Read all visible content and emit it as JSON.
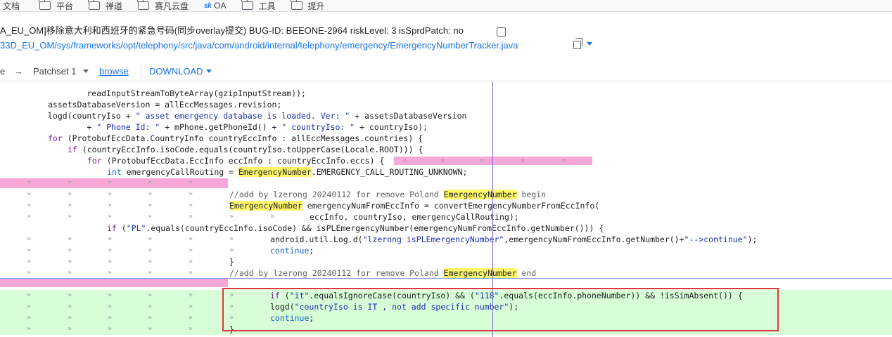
{
  "bookmarks": [
    {
      "label": "文档",
      "icon": "none"
    },
    {
      "label": "平台",
      "icon": "folder-icon"
    },
    {
      "label": "禅道",
      "icon": "folder-icon"
    },
    {
      "label": "赛凡云盘",
      "icon": "folder-icon"
    },
    {
      "label": "OA",
      "icon": "oa-logo-icon"
    },
    {
      "label": "工具",
      "icon": "folder-icon"
    },
    {
      "label": "提升",
      "icon": "folder-icon"
    }
  ],
  "oa_logo_text": "sk",
  "change": {
    "subject": "A_EU_OM]移除意大利和西班牙的紧急号码(同步overlay提交) BUG-ID: BEEONE-2964 riskLevel: 3 isSprdPatch: no",
    "file_path": "33D_EU_OM/sys/frameworks/opt/telephony/src/java/com/android/internal/telephony/emergency/EmergencyNumberTracker.java"
  },
  "toolbar": {
    "prev": "e",
    "arrow": "→",
    "patchset": "Patchset 1",
    "browse": "browse",
    "download": "DOWNLOAD"
  },
  "tab_glyph": "»",
  "diff_lines": [
    {
      "text": "        readInputStreamToByteArray(gzipInputStream));"
    },
    {
      "text": "assetsDatabaseVersion = allEccMessages.revision;"
    },
    {
      "p1": "logd(countryIso + ",
      "s1": "\" asset emergency database is loaded. Ver: \"",
      "p2": " + assetsDatabaseVersion"
    },
    {
      "p1": "        + ",
      "s1": "\" Phone Id: \"",
      "p2": " + mPhone.getPhoneId() + ",
      "s2": "\" countryIso: \"",
      "p3": " + countryIso);"
    },
    {
      "kw": "for",
      "rest": " (ProtobufEccData.CountryInfo countryEccInfo : allEccMessages.countries) {"
    },
    {
      "kw": "if",
      "rest": " (countryEccInfo.isoCode.equals(countryIso.toUpperCase(Locale.ROOT))) {"
    },
    {
      "kw": "for",
      "rest": " (ProtobufEccData.EccInfo eccInfo : countryEccInfo.eccs) {"
    },
    {
      "kw": "int",
      "p1": " emergencyCallRouting = ",
      "hl": "EmergencyNumber",
      "p2": ".EMERGENCY_CALL_ROUTING_UNKNOWN;"
    },
    {
      "cmt1": "//add by lzerong 20240112 for remove Poland ",
      "hl": "EmergencyNumber",
      "cmt2": " begin"
    },
    {
      "hl": "EmergencyNumber",
      "p1": " emergencyNumFromEccInfo = convertEmergencyNumberFromEccInfo("
    },
    {
      "text": "eccInfo, countryIso, emergencyCallRouting);"
    },
    {
      "kw": "if",
      "p1": " (",
      "s1": "\"PL\"",
      "p2": ".equals(countryEccInfo.isoCode) && isPLEmergencyNumber(emergencyNumFromEccInfo.getNumber())) {"
    },
    {
      "p1": "android.util.Log.d(",
      "s1": "\"lzerong isPLEmergencyNumber\"",
      "p2": ",emergencyNumFromEccInfo.getNumber()+",
      "s2": "\"-->continue\"",
      "p3": ");"
    },
    {
      "kw": "continue",
      "p1": ";"
    },
    {
      "text": "}"
    },
    {
      "cmt1": "//add by lzerong 20240112 for remove Poland ",
      "hl": "EmergencyNumber",
      "cmt2": " end"
    },
    {
      "kw": "if",
      "p1": " (",
      "s1": "\"it\"",
      "p2": ".equalsIgnoreCase(countryIso) && (",
      "s2": "\"118\"",
      "p3": ".equals(eccInfo.phoneNumber)) && !isSimAbsent()) {"
    },
    {
      "p1": "logd(",
      "s1": "\"countryIso is IT , not add specific number\"",
      "p2": ");"
    },
    {
      "kw": "continue",
      "p1": ";"
    },
    {
      "text": "}"
    }
  ]
}
